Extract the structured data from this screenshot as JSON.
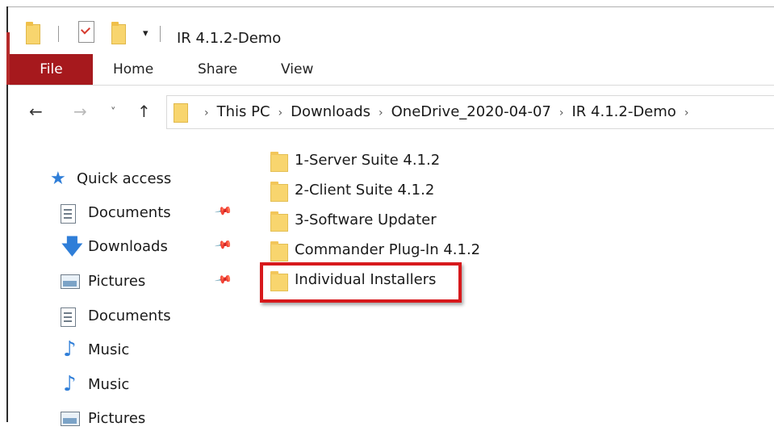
{
  "window": {
    "title": "IR 4.1.2-Demo",
    "qa_dropdown_glyph": "▾"
  },
  "ribbon": {
    "tabs": [
      "File",
      "Home",
      "Share",
      "View"
    ]
  },
  "navigation": {
    "back_glyph": "←",
    "forward_glyph": "→",
    "recent_glyph": "˅",
    "up_glyph": "↑",
    "crumb_separator": "›",
    "breadcrumbs": [
      "This PC",
      "Downloads",
      "OneDrive_2020-04-07",
      "IR 4.1.2-Demo"
    ]
  },
  "nav_pane": {
    "quick_access": "Quick access",
    "pin_glyph": "📌",
    "items": [
      {
        "label": "Documents",
        "icon": "documents-icon",
        "pinned": true
      },
      {
        "label": "Downloads",
        "icon": "downloads-icon",
        "pinned": true
      },
      {
        "label": "Pictures",
        "icon": "pictures-icon",
        "pinned": true
      },
      {
        "label": "Documents",
        "icon": "documents-icon",
        "pinned": false
      },
      {
        "label": "Music",
        "icon": "music-icon",
        "pinned": false
      },
      {
        "label": "Music",
        "icon": "music-icon",
        "pinned": false
      },
      {
        "label": "Pictures",
        "icon": "pictures-icon",
        "pinned": false
      }
    ]
  },
  "files": [
    {
      "name": "1-Server Suite 4.1.2",
      "icon": "folder-icon"
    },
    {
      "name": "2-Client Suite 4.1.2",
      "icon": "folder-icon"
    },
    {
      "name": "3-Software Updater",
      "icon": "folder-icon"
    },
    {
      "name": "Commander Plug-In 4.1.2",
      "icon": "folder-icon"
    },
    {
      "name": "Individual Installers",
      "icon": "folder-icon",
      "highlighted": true
    }
  ],
  "colors": {
    "file_tab": "#a6191d",
    "highlight": "#d7191c",
    "folder": "#f8d56e",
    "accent_blue": "#2f7ed8"
  }
}
